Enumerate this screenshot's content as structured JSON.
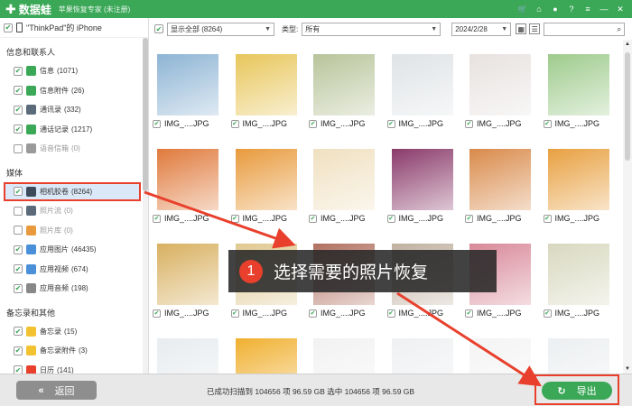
{
  "app": {
    "name": "数据蛙",
    "subtitle": "苹果恢复专家 (未注册)",
    "colors": {
      "brand": "#3aa857",
      "highlight": "#e8402c"
    }
  },
  "titlebar_icons": [
    "cart-icon",
    "gift-icon",
    "person-icon",
    "help-icon",
    "menu-icon",
    "minimize-icon",
    "close-icon"
  ],
  "sidebar": {
    "device": "\"ThinkPad\"的 iPhone",
    "sections": [
      {
        "title": "信息和联系人",
        "items": [
          {
            "label": "信息",
            "count": "(1071)",
            "checked": true,
            "disabled": false,
            "icon": "message-icon",
            "color": "#3aa857"
          },
          {
            "label": "信息附件",
            "count": "(26)",
            "checked": true,
            "disabled": false,
            "icon": "message-attachment-icon",
            "color": "#3aa857"
          },
          {
            "label": "通讯录",
            "count": "(332)",
            "checked": true,
            "disabled": false,
            "icon": "contacts-icon",
            "color": "#5b6b7a"
          },
          {
            "label": "通话记录",
            "count": "(1217)",
            "checked": true,
            "disabled": false,
            "icon": "phone-icon",
            "color": "#3aa857"
          },
          {
            "label": "语音信箱",
            "count": "(0)",
            "checked": false,
            "disabled": true,
            "icon": "voicemail-icon",
            "color": "#9a9a9a"
          }
        ]
      },
      {
        "title": "媒体",
        "items": [
          {
            "label": "相机胶卷",
            "count": "(8264)",
            "checked": true,
            "disabled": false,
            "selected": true,
            "icon": "camera-icon",
            "color": "#3d4a5c"
          },
          {
            "label": "照片流",
            "count": "(0)",
            "checked": false,
            "disabled": true,
            "icon": "photo-stream-icon",
            "color": "#5b6b7a"
          },
          {
            "label": "照片库",
            "count": "(0)",
            "checked": false,
            "disabled": true,
            "icon": "photo-library-icon",
            "color": "#e89a3c"
          },
          {
            "label": "应用图片",
            "count": "(46435)",
            "checked": true,
            "disabled": false,
            "icon": "app-photo-icon",
            "color": "#4a90d9"
          },
          {
            "label": "应用视频",
            "count": "(674)",
            "checked": true,
            "disabled": false,
            "icon": "app-video-icon",
            "color": "#4a90d9"
          },
          {
            "label": "应用音频",
            "count": "(198)",
            "checked": true,
            "disabled": false,
            "icon": "music-icon",
            "color": "#888888"
          }
        ]
      },
      {
        "title": "备忘录和其他",
        "items": [
          {
            "label": "备忘录",
            "count": "(15)",
            "checked": true,
            "disabled": false,
            "icon": "notes-icon",
            "color": "#f2c230"
          },
          {
            "label": "备忘录附件",
            "count": "(3)",
            "checked": true,
            "disabled": false,
            "icon": "notes-attachment-icon",
            "color": "#f2c230"
          },
          {
            "label": "日历",
            "count": "(141)",
            "checked": true,
            "disabled": false,
            "icon": "calendar-icon",
            "color": "#e8402c"
          }
        ]
      }
    ]
  },
  "toolbar": {
    "filter_value": "显示全部 (8264)",
    "type_label": "类型:",
    "type_value": "所有",
    "date_value": "2024/2/28",
    "search_placeholder": ""
  },
  "photos": {
    "file_label": "IMG_....JPG",
    "rows": [
      [
        "#8db4d4",
        "#e8c65a",
        "#b8c49a",
        "#dfe3e6",
        "#e7e2e0",
        "#9ecb8c"
      ],
      [
        "#e07a3c",
        "#e89a3c",
        "#f0e0c0",
        "#8a3a6a",
        "#d98a4a",
        "#e8a040"
      ],
      [
        "#d8b060",
        "#e0c890",
        "#b07060",
        "#c0b0a0",
        "#d88898",
        "#d8d8c0"
      ],
      [
        "#e8ecef",
        "#f0b030",
        "#f2f2f2",
        "#eef0f2",
        "#f4f4f4",
        "#eceff1"
      ]
    ]
  },
  "callout": {
    "number": "1",
    "text": "选择需要的照片恢复"
  },
  "bottom": {
    "back_label": "返回",
    "status_text": "已成功扫描到 104656 项 96.59 GB  选中 104656 项 96.59 GB",
    "export_label": "导出"
  }
}
